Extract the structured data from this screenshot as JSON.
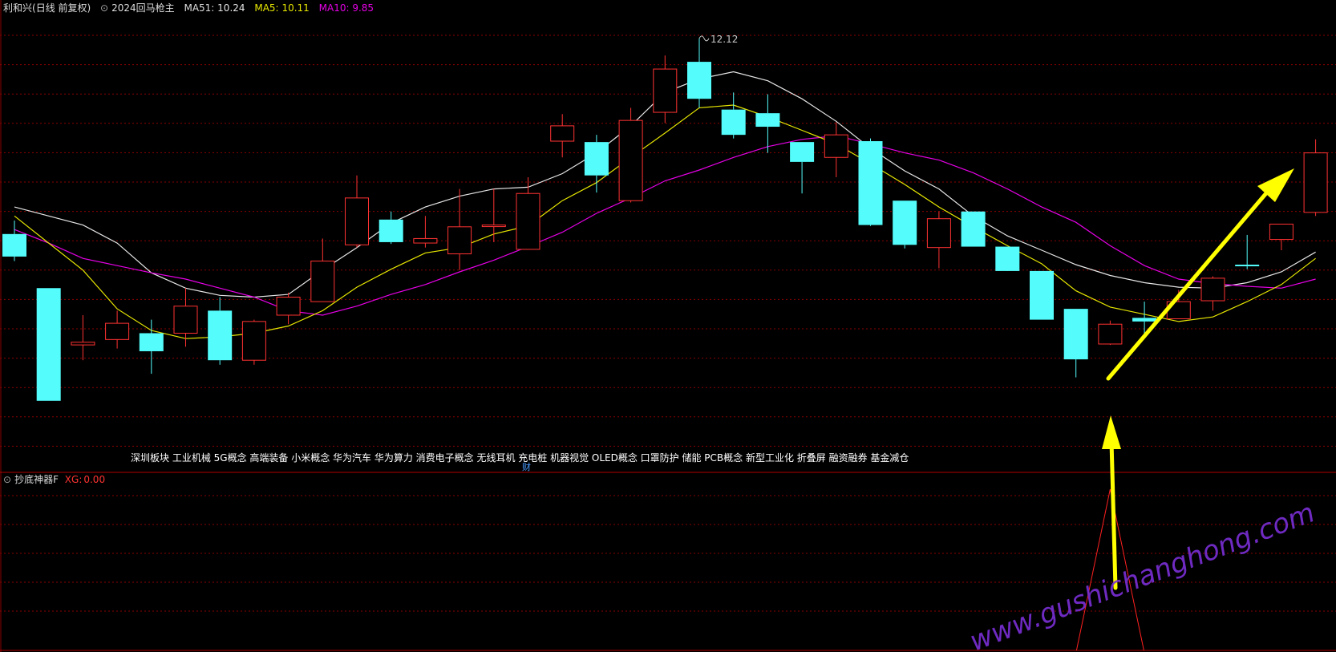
{
  "header": {
    "stock_name": "利和兴",
    "period": "(日线 前复权)",
    "strategy": "2024回马枪主",
    "ma51_label": "MA51:",
    "ma51_value": "10.24",
    "ma5_label": "MA5:",
    "ma5_value": "10.11",
    "ma10_label": "MA10:",
    "ma10_value": "9.85"
  },
  "indicator_panel": {
    "name": "抄底神器F",
    "xg_label": "XG:",
    "xg_value": "0.00"
  },
  "concepts": {
    "text": "深圳板块 工业机械 5G概念 高端装备 小米概念 华为汽车 华为算力 消费电子概念 无线耳机 充电桩 机器视觉 OLED概念 口罩防护 储能 PCB概念 新型工业化 折叠屏 融资融券 基金减仓",
    "tail": "财"
  },
  "watermark": "www.gushichanghong.com",
  "colors": {
    "up": "#ff3232",
    "down": "#54fcfc",
    "ma51": "#e6e6e6",
    "ma5": "#e6e600",
    "ma10": "#e600e6",
    "grid": "#8a0000",
    "arrow": "#ffff00",
    "xg_line": "#ff2020"
  },
  "chart_data": {
    "type": "candlestick",
    "max_label": "12.12",
    "ylim": [
      7.6,
      12.35
    ],
    "candles": [
      {
        "o": 9.95,
        "h": 10.1,
        "l": 9.65,
        "c": 9.7
      },
      {
        "o": 9.35,
        "h": 9.35,
        "l": 8.1,
        "c": 8.1
      },
      {
        "o": 8.72,
        "h": 9.05,
        "l": 8.55,
        "c": 8.75
      },
      {
        "o": 8.78,
        "h": 9.1,
        "l": 8.68,
        "c": 8.96
      },
      {
        "o": 8.85,
        "h": 9.0,
        "l": 8.4,
        "c": 8.65
      },
      {
        "o": 8.85,
        "h": 9.35,
        "l": 8.7,
        "c": 9.15
      },
      {
        "o": 9.1,
        "h": 9.25,
        "l": 8.5,
        "c": 8.55
      },
      {
        "o": 8.55,
        "h": 9.0,
        "l": 8.5,
        "c": 8.98
      },
      {
        "o": 9.05,
        "h": 9.3,
        "l": 8.95,
        "c": 9.25
      },
      {
        "o": 9.2,
        "h": 9.9,
        "l": 9.2,
        "c": 9.65
      },
      {
        "o": 9.83,
        "h": 10.6,
        "l": 9.8,
        "c": 10.35
      },
      {
        "o": 10.11,
        "h": 10.2,
        "l": 9.84,
        "c": 9.86
      },
      {
        "o": 9.85,
        "h": 10.15,
        "l": 9.8,
        "c": 9.9
      },
      {
        "o": 9.73,
        "h": 10.45,
        "l": 9.55,
        "c": 10.03
      },
      {
        "o": 10.04,
        "h": 10.45,
        "l": 9.86,
        "c": 10.05
      },
      {
        "o": 9.78,
        "h": 10.58,
        "l": 9.78,
        "c": 10.4
      },
      {
        "o": 10.98,
        "h": 11.28,
        "l": 10.8,
        "c": 11.15
      },
      {
        "o": 10.97,
        "h": 11.05,
        "l": 10.41,
        "c": 10.6
      },
      {
        "o": 10.32,
        "h": 11.35,
        "l": 10.3,
        "c": 11.21
      },
      {
        "o": 11.3,
        "h": 11.93,
        "l": 11.18,
        "c": 11.78
      },
      {
        "o": 11.86,
        "h": 12.12,
        "l": 11.35,
        "c": 11.45
      },
      {
        "o": 11.33,
        "h": 11.52,
        "l": 11.01,
        "c": 11.05
      },
      {
        "o": 11.29,
        "h": 11.5,
        "l": 10.85,
        "c": 11.14
      },
      {
        "o": 10.97,
        "h": 10.97,
        "l": 10.4,
        "c": 10.75
      },
      {
        "o": 10.8,
        "h": 11.19,
        "l": 10.58,
        "c": 11.05
      },
      {
        "o": 10.98,
        "h": 11.01,
        "l": 10.04,
        "c": 10.05
      },
      {
        "o": 10.32,
        "h": 10.32,
        "l": 9.79,
        "c": 9.83
      },
      {
        "o": 9.8,
        "h": 10.2,
        "l": 9.57,
        "c": 10.12
      },
      {
        "o": 10.2,
        "h": 10.2,
        "l": 9.81,
        "c": 9.81
      },
      {
        "o": 9.81,
        "h": 9.81,
        "l": 9.55,
        "c": 9.54
      },
      {
        "o": 9.54,
        "h": 9.54,
        "l": 9.0,
        "c": 9.0
      },
      {
        "o": 9.12,
        "h": 9.12,
        "l": 8.36,
        "c": 8.56
      },
      {
        "o": 8.73,
        "h": 8.99,
        "l": 8.72,
        "c": 8.95
      },
      {
        "o": 9.02,
        "h": 9.2,
        "l": 8.8,
        "c": 8.98
      },
      {
        "o": 9.01,
        "h": 9.33,
        "l": 9.01,
        "c": 9.2
      },
      {
        "o": 9.21,
        "h": 9.48,
        "l": 9.1,
        "c": 9.46
      },
      {
        "o": 9.61,
        "h": 9.94,
        "l": 9.56,
        "c": 9.6
      },
      {
        "o": 9.89,
        "h": 10.0,
        "l": 9.77,
        "c": 10.06
      },
      {
        "o": 10.19,
        "h": 11.0,
        "l": 10.15,
        "c": 10.85
      }
    ],
    "ma51": [
      10.25,
      10.15,
      10.05,
      9.85,
      9.52,
      9.35,
      9.27,
      9.25,
      9.28,
      9.55,
      9.8,
      10.07,
      10.25,
      10.37,
      10.45,
      10.47,
      10.62,
      10.85,
      11.15,
      11.52,
      11.67,
      11.75,
      11.65,
      11.45,
      11.2,
      10.9,
      10.65,
      10.45,
      10.15,
      9.93,
      9.77,
      9.61,
      9.49,
      9.41,
      9.36,
      9.35,
      9.41,
      9.53,
      9.75
    ],
    "ma5": [
      10.15,
      9.85,
      9.55,
      9.12,
      8.88,
      8.79,
      8.81,
      8.85,
      8.93,
      9.1,
      9.36,
      9.56,
      9.74,
      9.8,
      9.95,
      10.04,
      10.32,
      10.52,
      10.8,
      11.07,
      11.35,
      11.38,
      11.25,
      11.1,
      10.95,
      10.73,
      10.5,
      10.25,
      10.03,
      9.82,
      9.62,
      9.32,
      9.14,
      9.06,
      8.98,
      9.03,
      9.2,
      9.39,
      9.68
    ],
    "ma10": [
      10.0,
      9.85,
      9.68,
      9.6,
      9.52,
      9.45,
      9.35,
      9.25,
      9.1,
      9.05,
      9.15,
      9.28,
      9.39,
      9.53,
      9.66,
      9.81,
      9.97,
      10.18,
      10.35,
      10.54,
      10.66,
      10.8,
      10.92,
      11.0,
      11.04,
      10.95,
      10.85,
      10.77,
      10.63,
      10.45,
      10.25,
      10.08,
      9.82,
      9.6,
      9.45,
      9.4,
      9.37,
      9.35,
      9.45
    ],
    "xg_signal_index": 32
  }
}
